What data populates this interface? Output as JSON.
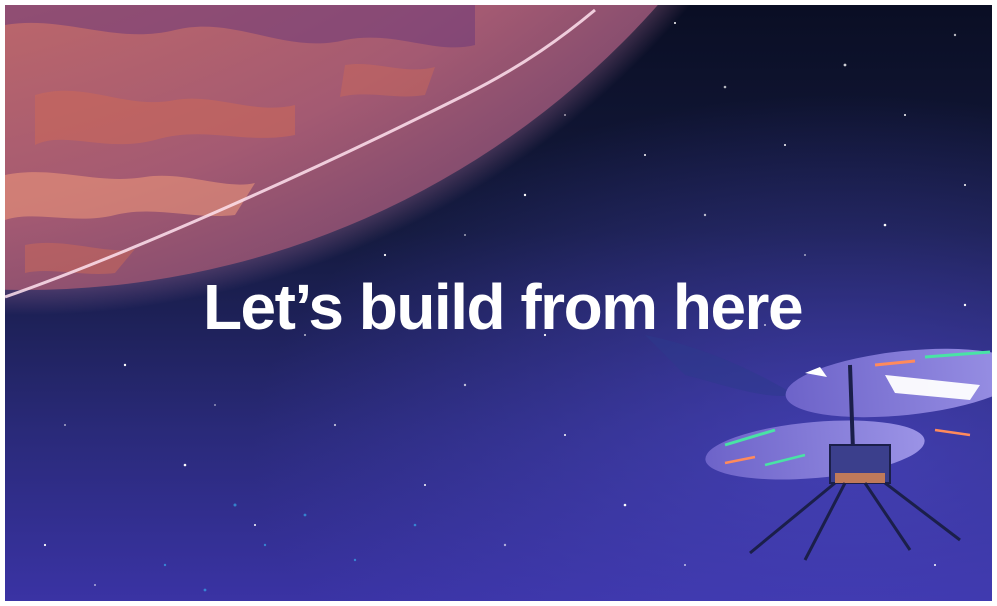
{
  "hero": {
    "headline": "Let’s build from here",
    "illustration": {
      "planet": "mars-planet",
      "vehicle": "mars-helicopter",
      "background": "starfield"
    },
    "colors": {
      "space_top": "#0a0e24",
      "space_bottom": "#3a33a4",
      "planet": "#e07a5f",
      "planet_rim": "#ffd6e6",
      "headline": "#ffffff"
    }
  }
}
